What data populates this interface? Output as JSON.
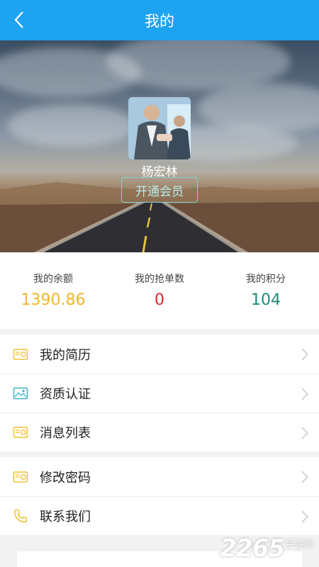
{
  "header": {
    "title": "我的",
    "back_icon": "back-arrow-icon"
  },
  "profile": {
    "username": "杨宏林",
    "vip_button": "开通会员"
  },
  "stats": [
    {
      "label": "我的余额",
      "value": "1390.86",
      "color": "#f0b62a"
    },
    {
      "label": "我的抢单数",
      "value": "0",
      "color": "#d9272e"
    },
    {
      "label": "我的积分",
      "value": "104",
      "color": "#1f8c7a"
    }
  ],
  "menu_group1": [
    {
      "label": "我的简历",
      "icon": "resume-card-icon"
    },
    {
      "label": "资质认证",
      "icon": "image-icon"
    },
    {
      "label": "消息列表",
      "icon": "message-card-icon"
    }
  ],
  "menu_group2": [
    {
      "label": "修改密码",
      "icon": "password-card-icon"
    },
    {
      "label": "联系我们",
      "icon": "phone-icon"
    }
  ],
  "watermark": {
    "number": "2265",
    "suffix": "手游网"
  },
  "colors": {
    "topbar": "#1ea3f0",
    "icon_yellow": "#f2c230",
    "icon_teal": "#3ab6c7"
  }
}
